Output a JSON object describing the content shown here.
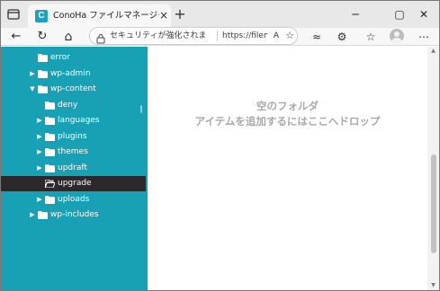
{
  "browser": {
    "tab_title": "ConoHa ファイルマネージャー",
    "favicon_letter": "C",
    "tab_close": "×",
    "new_tab": "+",
    "window_buttons": {
      "minimize": "─",
      "maximize": "▢",
      "close": "✕"
    },
    "icons": {
      "back": "arrow-left-icon",
      "refresh": "refresh-icon",
      "home": "home-icon",
      "lock": "lock-icon",
      "read_aloud": "read-aloud-icon",
      "favorite_add": "star-add-icon",
      "tracking": "tracking-prevention-icon",
      "extensions": "puzzle-icon",
      "favorites": "favorites-icon",
      "profile": "avatar-icon",
      "more": "more-icon"
    },
    "glyphs": {
      "back": "←",
      "refresh": "↻",
      "home": "⌂",
      "read_aloud": "A",
      "favorite_add": "☆",
      "tracking": "≈",
      "extensions": "⚙",
      "favorites": "☆",
      "more": "⋯"
    },
    "address": {
      "security_text": "セキュリティが強化されま",
      "url_text": "https://filem..."
    }
  },
  "colors": {
    "sidebar_bg": "#18a0b4",
    "selected_bg": "#2a2a2a",
    "empty_text": "#a9a9a9"
  },
  "sidebar": {
    "caret_collapsed": "▶",
    "caret_expanded": "▼",
    "items": [
      {
        "label": "error",
        "state": "none"
      },
      {
        "label": "wp-admin",
        "state": "collapsed"
      },
      {
        "label": "wp-content",
        "state": "expanded"
      },
      {
        "label": "deny",
        "state": "none"
      },
      {
        "label": "languages",
        "state": "collapsed"
      },
      {
        "label": "plugins",
        "state": "collapsed"
      },
      {
        "label": "themes",
        "state": "collapsed"
      },
      {
        "label": "updraft",
        "state": "collapsed"
      },
      {
        "label": "upgrade",
        "state": "selected"
      },
      {
        "label": "uploads",
        "state": "collapsed"
      },
      {
        "label": "wp-includes",
        "state": "collapsed"
      }
    ]
  },
  "main": {
    "empty_title": "空のフォルダ",
    "empty_hint": "アイテムを追加するにはここへドロップ"
  },
  "scrollbar": {
    "up": "▲",
    "down": "▼"
  }
}
